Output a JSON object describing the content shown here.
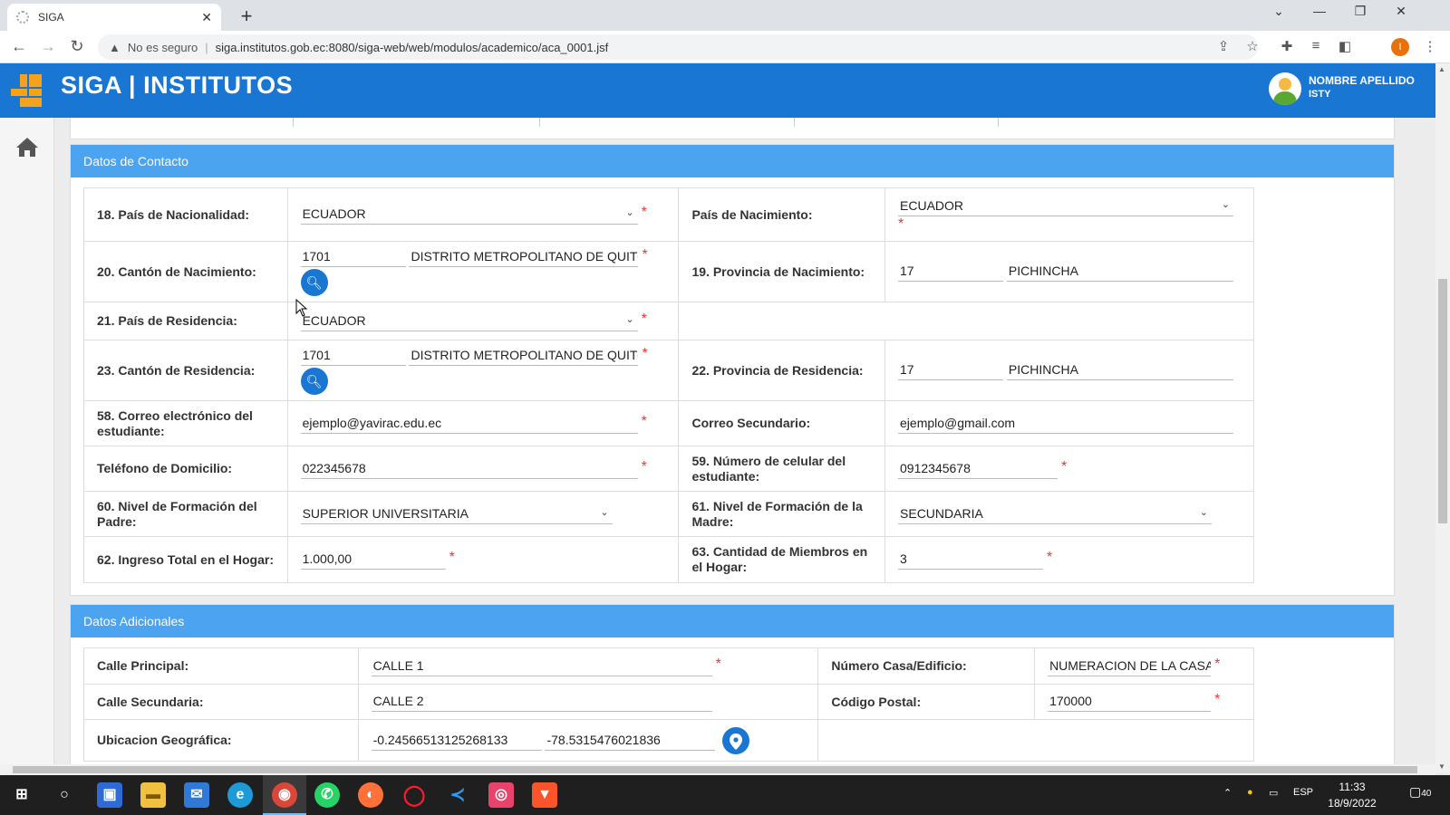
{
  "browser": {
    "tab_title": "SIGA",
    "new_tab": "+",
    "security_label": "No es seguro",
    "url": "siga.institutos.gob.ec:8080/siga-web/web/modulos/academico/aca_0001.jsf",
    "profile_initial": "I"
  },
  "app": {
    "title": "SIGA | INSTITUTOS",
    "user_name": "NOMBRE APELLIDO",
    "user_role": "ISTY"
  },
  "contact": {
    "header": "Datos de Contacto",
    "pais_nacionalidad": {
      "label": "18. País de Nacionalidad:",
      "value": "ECUADOR"
    },
    "pais_nacimiento": {
      "label": "País de Nacimiento:",
      "value": "ECUADOR"
    },
    "canton_nacimiento": {
      "label": "20. Cantón de Nacimiento:",
      "code": "1701",
      "name": "DISTRITO METROPOLITANO DE QUITO"
    },
    "provincia_nacimiento": {
      "label": "19. Provincia de Nacimiento:",
      "code": "17",
      "name": "PICHINCHA"
    },
    "pais_residencia": {
      "label": "21. País de Residencia:",
      "value": "ECUADOR"
    },
    "canton_residencia": {
      "label": "23. Cantón de Residencia:",
      "code": "1701",
      "name": "DISTRITO METROPOLITANO DE QUITO"
    },
    "provincia_residencia": {
      "label": "22. Provincia de Residencia:",
      "code": "17",
      "name": "PICHINCHA"
    },
    "correo_estudiante": {
      "label": "58. Correo electrónico del estudiante:",
      "value": "ejemplo@yavirac.edu.ec"
    },
    "correo_secundario": {
      "label": "Correo Secundario:",
      "value": "ejemplo@gmail.com"
    },
    "telefono_domicilio": {
      "label": "Teléfono de Domicilio:",
      "value": "022345678"
    },
    "celular": {
      "label": "59. Número de celular del estudiante:",
      "value": "0912345678"
    },
    "formacion_padre": {
      "label": "60. Nivel de Formación del Padre:",
      "value": "SUPERIOR UNIVERSITARIA"
    },
    "formacion_madre": {
      "label": "61. Nivel de Formación de la Madre:",
      "value": "SECUNDARIA"
    },
    "ingreso_hogar": {
      "label": "62. Ingreso Total en el Hogar:",
      "value": "1.000,00"
    },
    "miembros_hogar": {
      "label": "63. Cantidad de Miembros en el Hogar:",
      "value": "3"
    }
  },
  "additional": {
    "header": "Datos Adicionales",
    "calle_principal": {
      "label": "Calle Principal:",
      "value": "CALLE 1"
    },
    "numero_casa": {
      "label": "Número Casa/Edificio:",
      "value": "NUMERACION DE LA CASA"
    },
    "calle_secundaria": {
      "label": "Calle Secundaria:",
      "value": "CALLE 2"
    },
    "codigo_postal": {
      "label": "Código Postal:",
      "value": "170000"
    },
    "ubicacion": {
      "label": "Ubicacion Geográfica:",
      "lat": "-0.24566513125268133",
      "lng": "-78.5315476021836"
    }
  },
  "required_mark": "*",
  "taskbar": {
    "lang": "ESP",
    "time": "11:33",
    "date": "18/9/2022",
    "notifications": "40"
  },
  "colors": {
    "header_blue": "#1976d2",
    "panel_blue": "#4ca3f0",
    "required_red": "#e53935"
  }
}
